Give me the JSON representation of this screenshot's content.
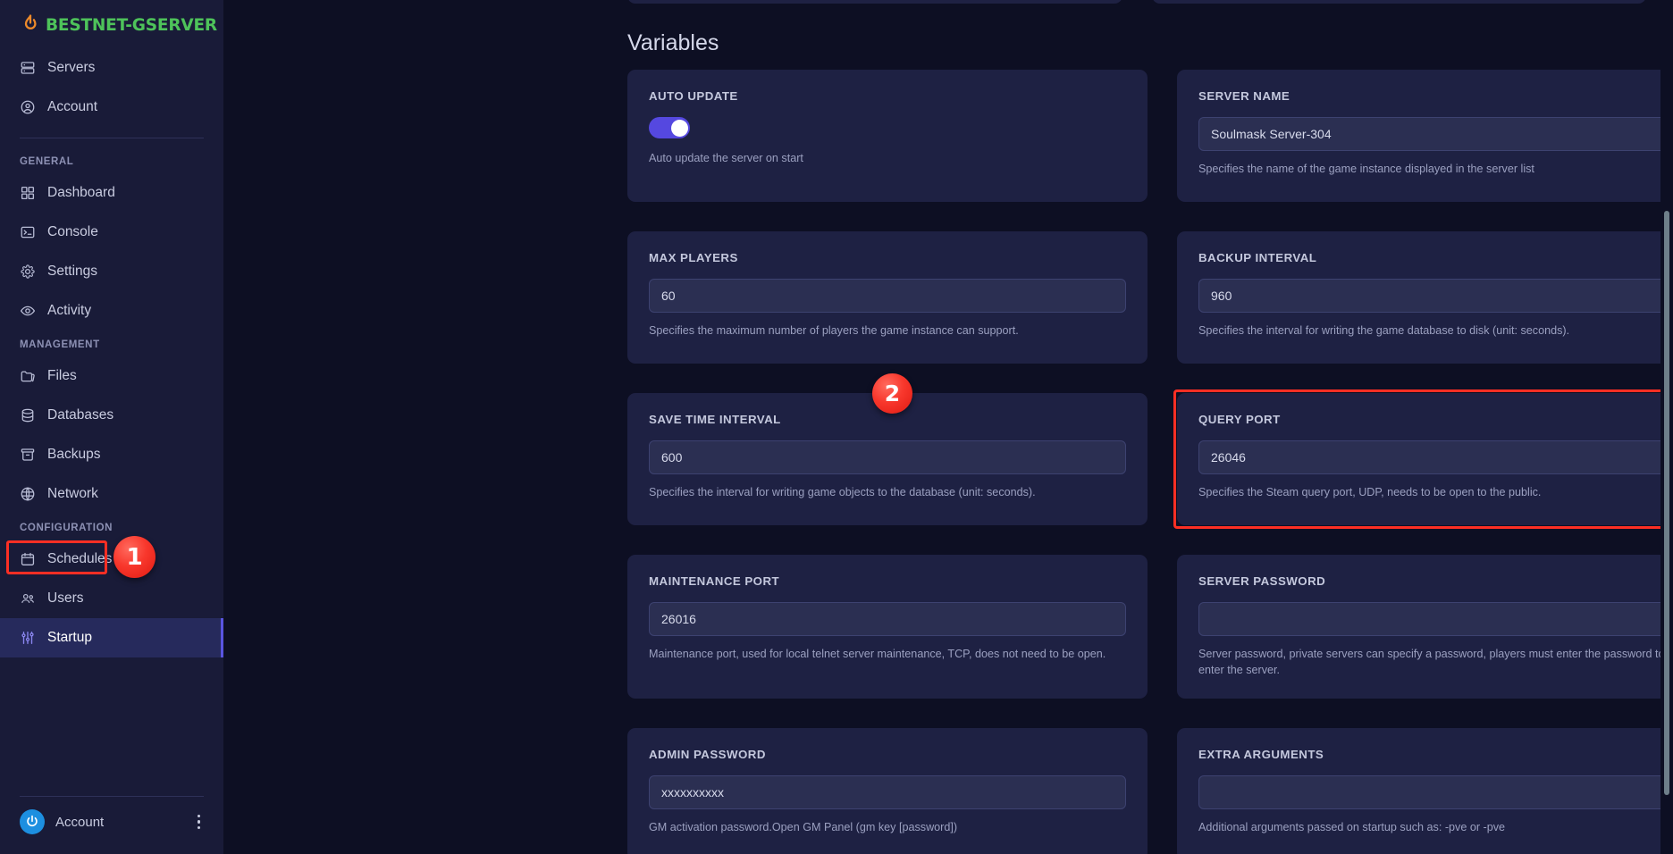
{
  "brand": {
    "name": "BESTNET-GSERVER",
    "logo_icon": "power-flame-icon",
    "color": "#4ec35a"
  },
  "sidebar": {
    "top_items": [
      {
        "label": "Servers",
        "icon": "server-rack-icon"
      },
      {
        "label": "Account",
        "icon": "user-circle-icon"
      }
    ],
    "groups": [
      {
        "title": "GENERAL",
        "items": [
          {
            "label": "Dashboard",
            "icon": "grid-squares-icon"
          },
          {
            "label": "Console",
            "icon": "terminal-icon"
          },
          {
            "label": "Settings",
            "icon": "gear-icon"
          },
          {
            "label": "Activity",
            "icon": "eye-icon"
          }
        ]
      },
      {
        "title": "MANAGEMENT",
        "items": [
          {
            "label": "Files",
            "icon": "folder-icon"
          },
          {
            "label": "Databases",
            "icon": "database-icon"
          },
          {
            "label": "Backups",
            "icon": "archive-box-icon"
          },
          {
            "label": "Network",
            "icon": "globe-icon"
          }
        ]
      },
      {
        "title": "CONFIGURATION",
        "items": [
          {
            "label": "Schedules",
            "icon": "calendar-icon"
          },
          {
            "label": "Users",
            "icon": "users-group-icon"
          },
          {
            "label": "Startup",
            "icon": "sliders-icon",
            "active": true
          }
        ]
      }
    ],
    "account": {
      "label": "Account",
      "avatar_icon": "power-avatar-icon",
      "menu_icon": "kebab-menu-icon"
    }
  },
  "main": {
    "section_title": "Variables",
    "cards": [
      {
        "label": "AUTO UPDATE",
        "type": "toggle",
        "toggle_on": true,
        "helper": "Auto update the server on start"
      },
      {
        "label": "SERVER NAME",
        "type": "text",
        "value": "Soulmask Server-304",
        "helper": "Specifies the name of the game instance displayed in the server list"
      },
      {
        "label": "MAX PLAYERS",
        "type": "text",
        "value": "60",
        "helper": "Specifies the maximum number of players the game instance can support."
      },
      {
        "label": "BACKUP INTERVAL",
        "type": "text",
        "value": "960",
        "helper": "Specifies the interval for writing the game database to disk (unit: seconds)."
      },
      {
        "label": "SAVE TIME INTERVAL",
        "type": "text",
        "value": "600",
        "helper": "Specifies the interval for writing game objects to the database (unit: seconds)."
      },
      {
        "label": "QUERY PORT",
        "type": "text",
        "value": "26046",
        "helper": "Specifies the Steam query port, UDP, needs to be open to the public.",
        "highlighted": true
      },
      {
        "label": "MAINTENANCE PORT",
        "type": "text",
        "value": "26016",
        "helper": "Maintenance port, used for local telnet server maintenance, TCP, does not need to be open."
      },
      {
        "label": "SERVER PASSWORD",
        "type": "text",
        "value": "",
        "helper": "Server password, private servers can specify a password, players must enter the password to enter the server."
      },
      {
        "label": "ADMIN PASSWORD",
        "type": "text",
        "value": "xxxxxxxxxx",
        "helper": "GM activation password.Open GM Panel (gm key [password])"
      },
      {
        "label": "EXTRA ARGUMENTS",
        "type": "text",
        "value": "",
        "helper": "Additional arguments passed on startup such as: -pve or -pve"
      }
    ]
  },
  "annotations": {
    "step_1": "1",
    "step_2": "2",
    "highlight_color": "#fc2f24"
  }
}
